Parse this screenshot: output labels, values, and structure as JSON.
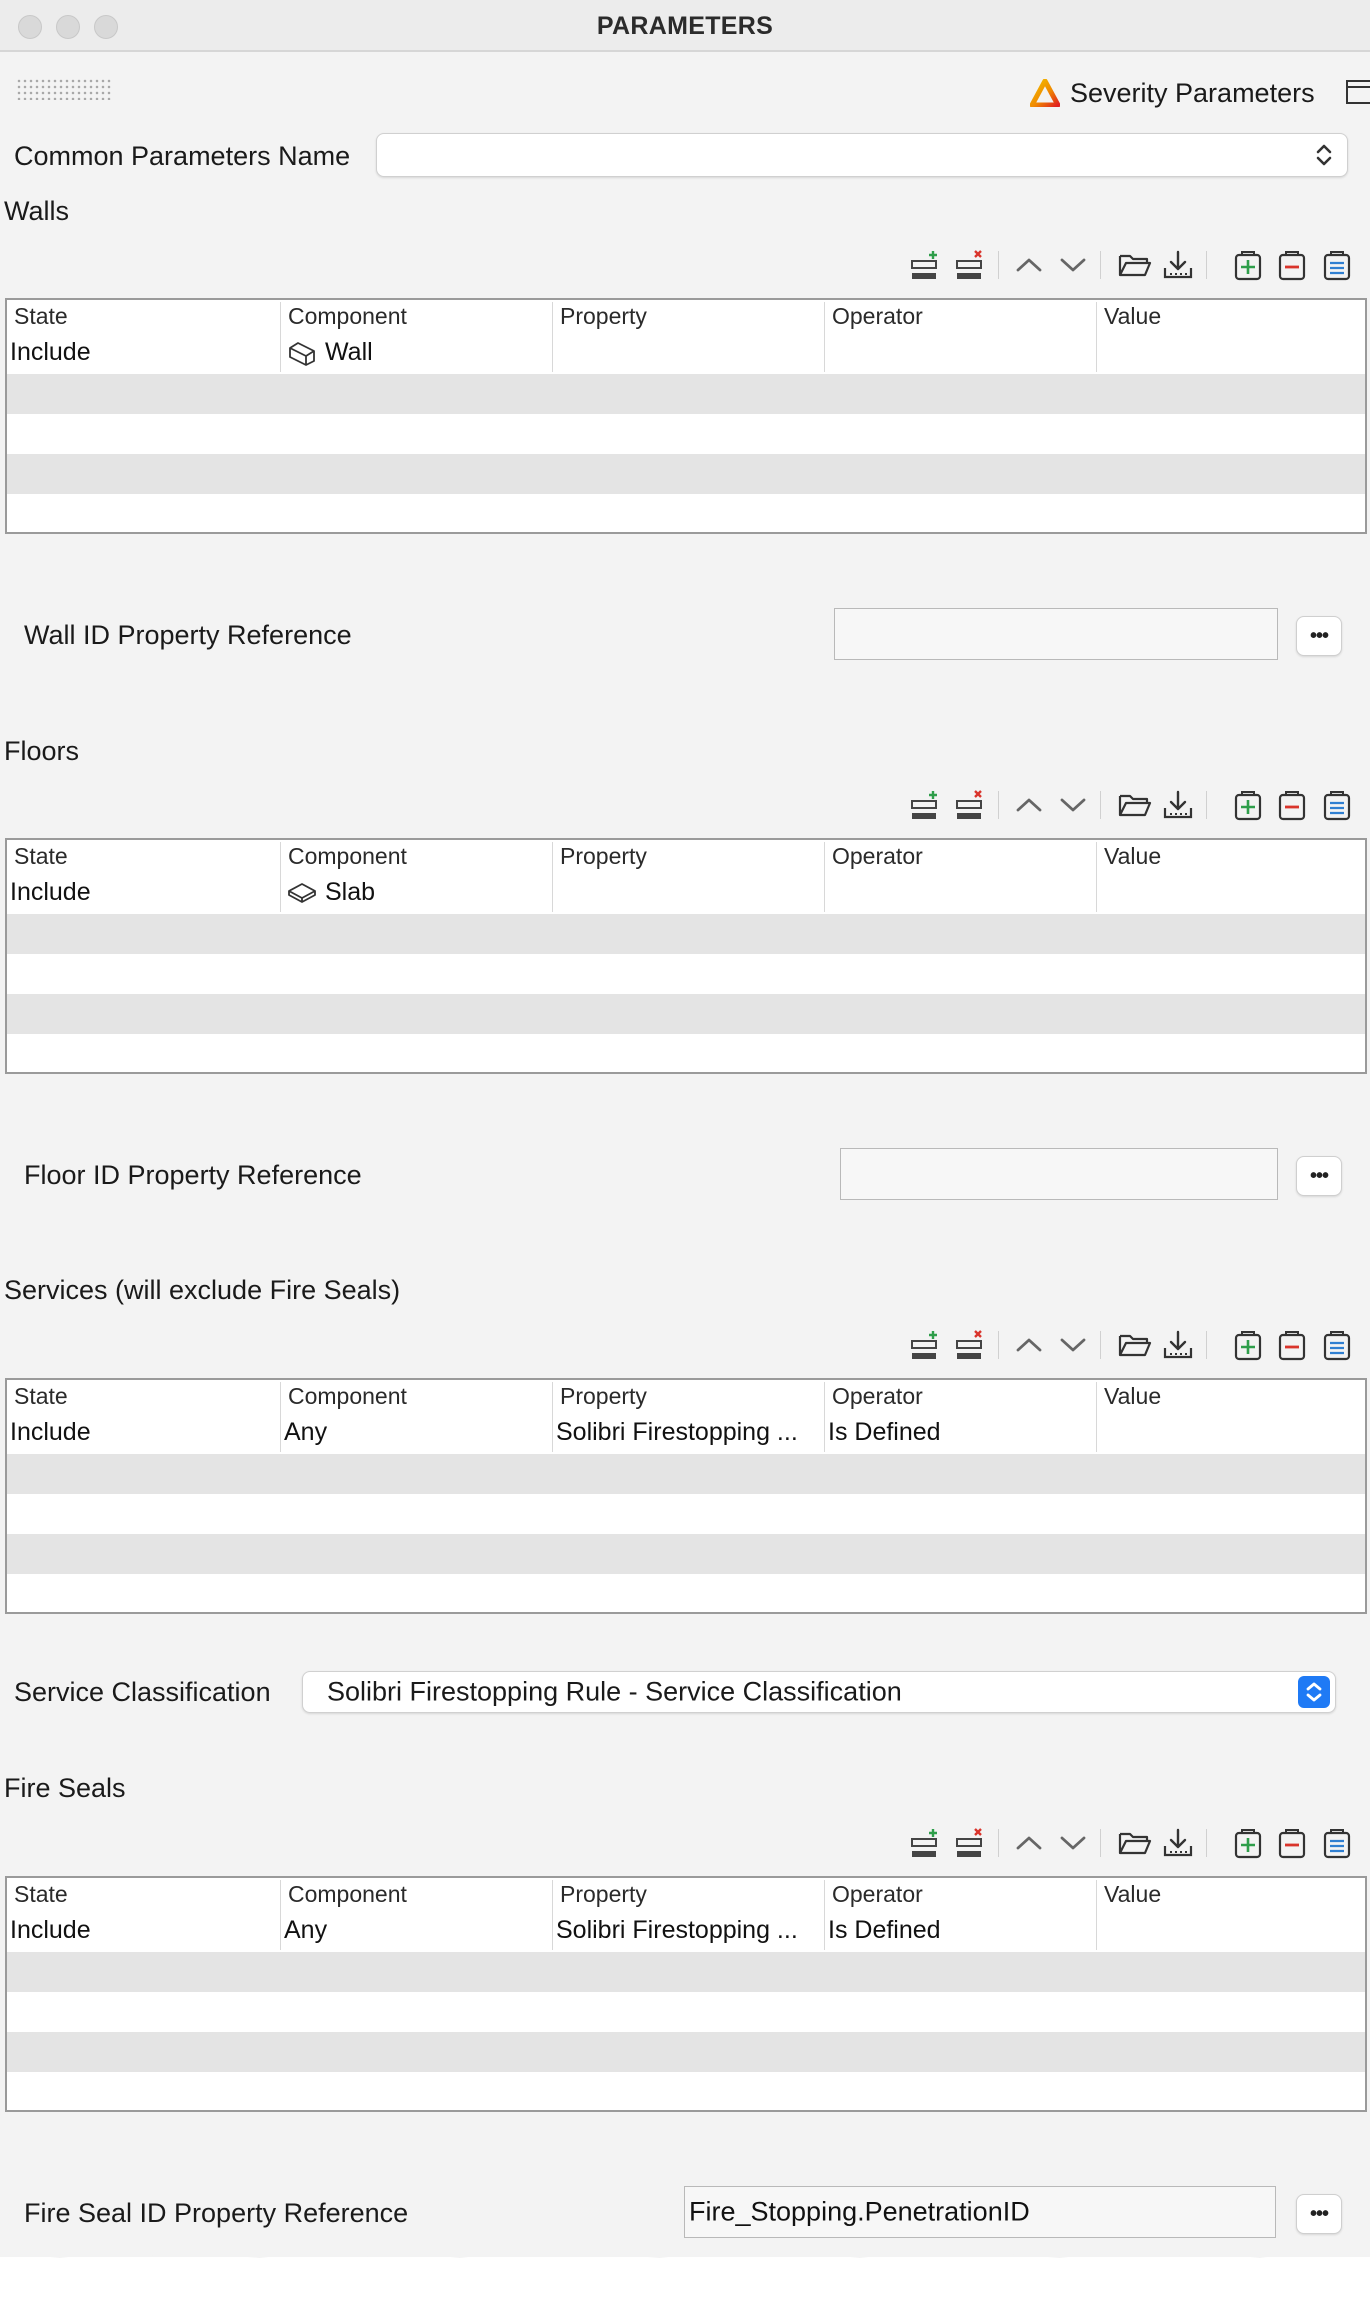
{
  "window": {
    "title": "PARAMETERS"
  },
  "header": {
    "severity_label": "Severity Parameters"
  },
  "common_params": {
    "label": "Common Parameters Name",
    "value": ""
  },
  "columns": [
    "State",
    "Component",
    "Property",
    "Operator",
    "Value"
  ],
  "sections": {
    "walls": {
      "title": "Walls",
      "rows": [
        {
          "state": "Include",
          "component": "Wall",
          "component_icon": "wall-icon",
          "property": "",
          "operator": "",
          "value": ""
        }
      ],
      "ref_label": "Wall ID Property Reference",
      "ref_value": ""
    },
    "floors": {
      "title": "Floors",
      "rows": [
        {
          "state": "Include",
          "component": "Slab",
          "component_icon": "slab-icon",
          "property": "",
          "operator": "",
          "value": ""
        }
      ],
      "ref_label": "Floor ID Property Reference",
      "ref_value": ""
    },
    "services": {
      "title": "Services (will exclude Fire Seals)",
      "rows": [
        {
          "state": "Include",
          "component": "Any",
          "property": "Solibri Firestopping ...",
          "operator": "Is Defined",
          "value": ""
        }
      ],
      "classification_label": "Service Classification",
      "classification_value": "Solibri Firestopping Rule - Service Classification"
    },
    "fire_seals": {
      "title": "Fire Seals",
      "rows": [
        {
          "state": "Include",
          "component": "Any",
          "property": "Solibri Firestopping ...",
          "operator": "Is Defined",
          "value": ""
        }
      ],
      "ref_label": "Fire Seal ID Property Reference",
      "ref_value": "Fire_Stopping.PenetrationID"
    }
  },
  "toolbar_icons": [
    "add-row-icon",
    "remove-row-icon",
    "move-up-icon",
    "move-down-icon",
    "open-folder-icon",
    "import-icon",
    "add-group-icon",
    "remove-group-icon",
    "edit-group-icon"
  ],
  "colors": {
    "accent_blue": "#1f7af5",
    "add_green": "#2e9e4a",
    "remove_red": "#d9342b",
    "edit_blue": "#2f7fd1"
  }
}
